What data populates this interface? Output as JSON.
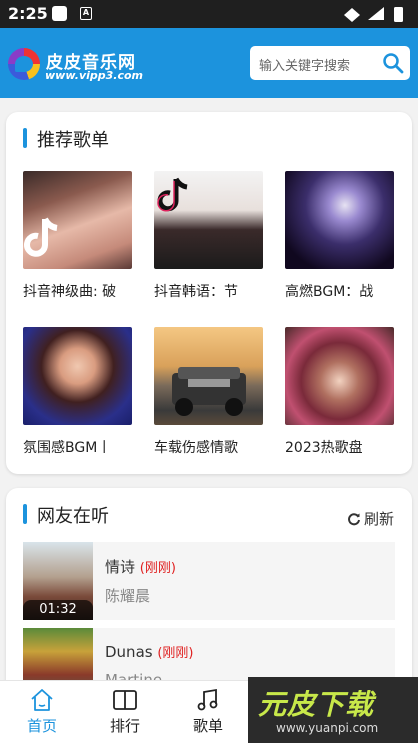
{
  "status_bar": {
    "time": "2:25",
    "a_icon": "A"
  },
  "header": {
    "logo_title": "皮皮音乐网",
    "logo_subtitle": "www.vipp3.com",
    "search_placeholder": "输入关键字搜索"
  },
  "recommended": {
    "title": "推荐歌单",
    "playlists": [
      {
        "name": "抖音神级曲: 破"
      },
      {
        "name": "抖音韩语：节"
      },
      {
        "name": "高燃BGM：战"
      },
      {
        "name": "氛围感BGM丨"
      },
      {
        "name": "车载伤感情歌"
      },
      {
        "name": "2023热歌盘"
      }
    ]
  },
  "listening": {
    "title": "网友在听",
    "refresh_label": "刷新",
    "songs": [
      {
        "title": "情诗",
        "tag": "(刚刚)",
        "artist": "陈耀晨",
        "duration": "01:32"
      },
      {
        "title": "Dunas",
        "tag": "(刚刚)",
        "artist": "Martine"
      }
    ]
  },
  "nav": {
    "items": [
      {
        "label": "首页"
      },
      {
        "label": "排行"
      },
      {
        "label": "歌单"
      }
    ]
  },
  "watermark": {
    "text_main": "元皮下载",
    "url": "www.yuanpi.com"
  },
  "colors": {
    "accent": "#1c93dd",
    "tag_red": "#e02020"
  }
}
